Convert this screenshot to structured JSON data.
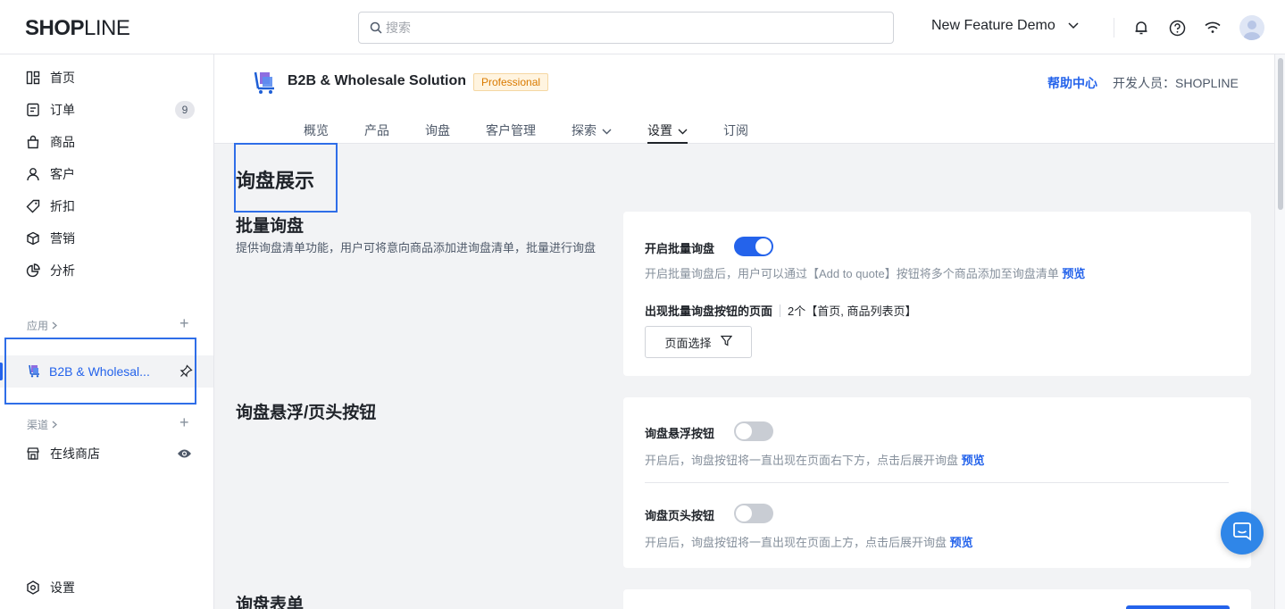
{
  "topbar": {
    "logo": {
      "bold": "SHOP",
      "thin": "LINE"
    },
    "search_placeholder": "搜索",
    "store_name": "New Feature Demo"
  },
  "sidebar": {
    "items": [
      {
        "label": "首页",
        "icon": "dashboard-icon"
      },
      {
        "label": "订单",
        "icon": "order-icon",
        "badge": "9"
      },
      {
        "label": "商品",
        "icon": "shopping-bag-icon"
      },
      {
        "label": "客户",
        "icon": "user-icon"
      },
      {
        "label": "折扣",
        "icon": "tag-icon"
      },
      {
        "label": "营销",
        "icon": "cube-icon"
      },
      {
        "label": "分析",
        "icon": "pie-chart-icon"
      }
    ],
    "apps_label": "应用",
    "app_item": "B2B & Wholesal...",
    "channels_label": "渠道",
    "online_store": "在线商店",
    "settings": "设置"
  },
  "app_header": {
    "title": "B2B & Wholesale Solution",
    "badge": "Professional",
    "help": "帮助中心",
    "developer": "开发人员：SHOPLINE",
    "tabs": [
      {
        "label": "概览"
      },
      {
        "label": "产品"
      },
      {
        "label": "询盘"
      },
      {
        "label": "客户管理"
      },
      {
        "label": "探索",
        "dropdown": true
      },
      {
        "label": "设置",
        "dropdown": true,
        "active": true
      },
      {
        "label": "订阅"
      }
    ]
  },
  "content": {
    "page_title": "询盘展示",
    "bulk": {
      "title": "批量询盘",
      "desc": "提供询盘清单功能，用户可将意向商品添加进询盘清单，批量进行询盘",
      "toggle_label": "开启批量询盘",
      "toggle_on": true,
      "toggle_desc": "开启批量询盘后，用户可以通过【Add to quote】按钮将多个商品添加至询盘清单",
      "preview": "预览",
      "pages_label": "出现批量询盘按钮的页面",
      "pages_value": "2个【首页, 商品列表页】",
      "filter_button": "页面选择"
    },
    "float": {
      "title": "询盘悬浮/页头按钮",
      "float_label": "询盘悬浮按钮",
      "float_on": false,
      "float_desc": "开启后，询盘按钮将一直出现在页面右下方，点击后展开询盘",
      "header_label": "询盘页头按钮",
      "header_on": false,
      "header_desc": "开启后，询盘按钮将一直出现在页面上方，点击后展开询盘",
      "preview": "预览"
    },
    "form": {
      "title": "询盘表单"
    }
  },
  "colors": {
    "accent": "#2463eb",
    "badge_text": "#d97a00",
    "highlight": "#2f6ee8"
  }
}
